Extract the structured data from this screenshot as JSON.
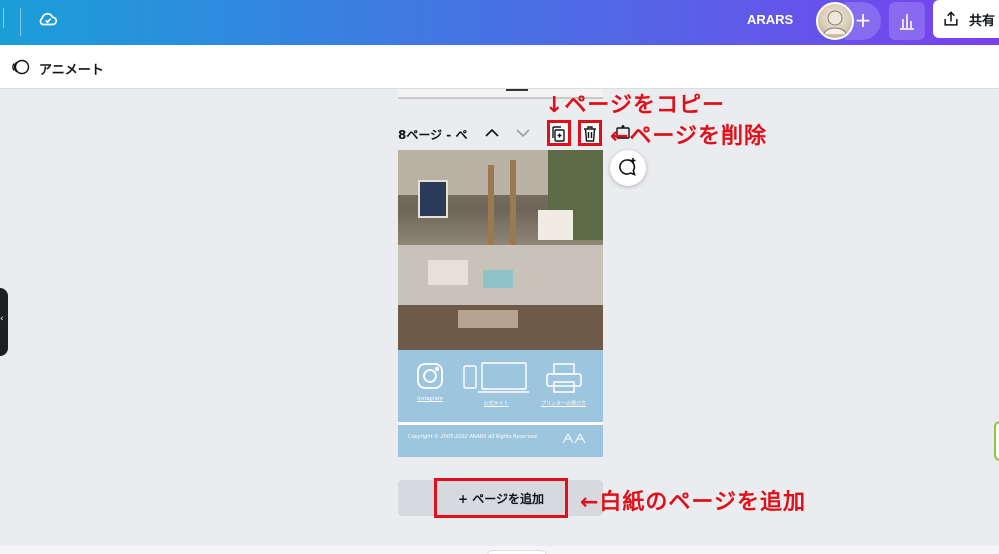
{
  "topbar": {
    "team_name": "ARARS",
    "add_member_symbol": "+",
    "share_label": "共有",
    "icons": [
      "cloud-check-icon",
      "avatar",
      "bar-chart-icon",
      "share-upload-icon"
    ]
  },
  "subbar": {
    "animate_label": "アニメート",
    "icon": "animate-icon"
  },
  "page": {
    "title": "8ページ - ペ",
    "controls": [
      "chevron-up-icon",
      "chevron-down-icon",
      "duplicate-page-icon",
      "trash-icon",
      "add-page-icon"
    ],
    "card": {
      "captions": [
        "Instagram",
        "公式サイト",
        "プリンターの選び方"
      ],
      "copyright": "Copyright © 2005-2022 ARARS All Rights Reserved."
    }
  },
  "add_page_button": {
    "label": "+ ページを追加"
  },
  "annotations": {
    "copy": "↓ページをコピー",
    "delete": "←ページを削除",
    "blank": "←白紙のページを追加"
  },
  "colors": {
    "annotation_red": "#e0101a",
    "topbar_start": "#1a9fd8",
    "topbar_end": "#7a3ff0",
    "card_footer_blue": "#9ec5df"
  }
}
